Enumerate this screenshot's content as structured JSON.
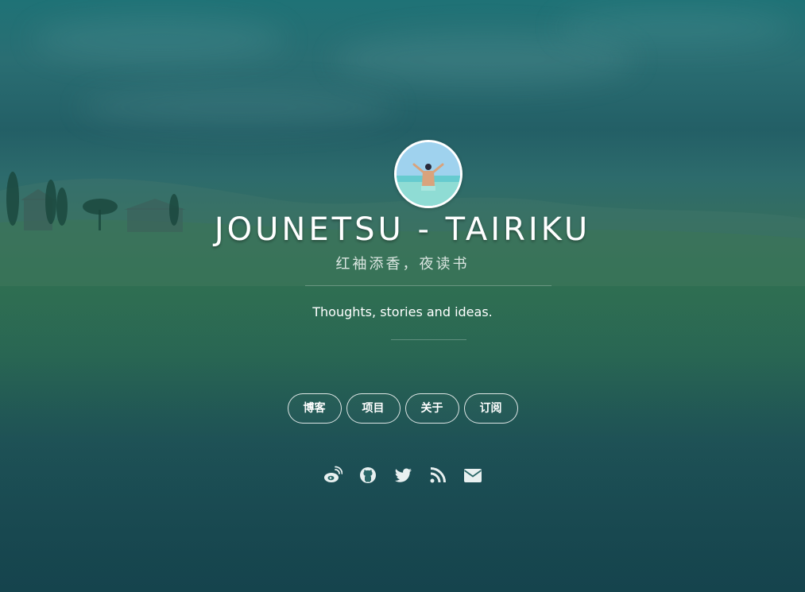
{
  "site": {
    "title": "JOUNETSU - TAIRIKU",
    "subtitle": "红袖添香，夜读书",
    "tagline": "Thoughts, stories and ideas."
  },
  "nav": {
    "items": [
      {
        "label": "博客"
      },
      {
        "label": "项目"
      },
      {
        "label": "关于"
      },
      {
        "label": "订阅"
      }
    ]
  },
  "social": {
    "icons": [
      "weibo-icon",
      "github-icon",
      "twitter-icon",
      "rss-icon",
      "email-icon"
    ]
  },
  "colors": {
    "background": "#1f6b70",
    "text": "#ffffff",
    "icon": "#e8f0f0"
  }
}
